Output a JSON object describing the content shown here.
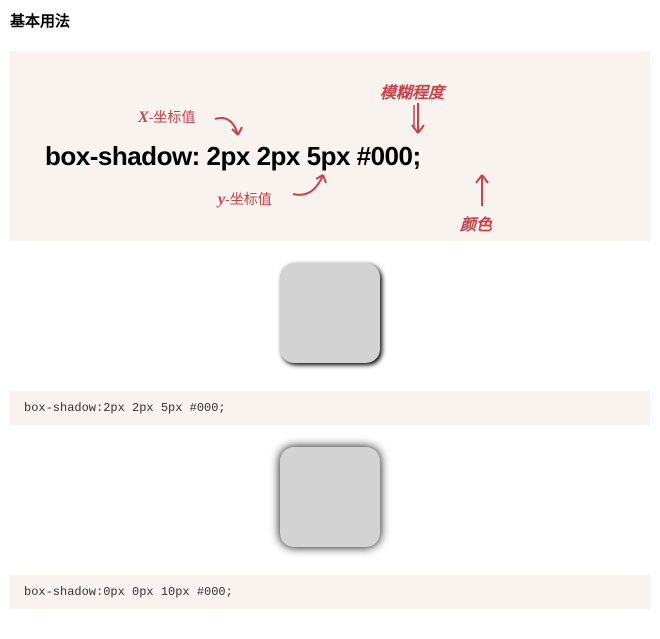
{
  "title": "基本用法",
  "main_css": "box-shadow: 2px 2px 5px #000;",
  "annotations": {
    "x_letter": "X",
    "x_suffix": "-坐标值",
    "y_letter": "y",
    "y_suffix": "-坐标值",
    "blur": "模糊程度",
    "color": "颜色"
  },
  "examples": [
    {
      "css": "box-shadow:2px 2px 5px #000;"
    },
    {
      "css": "box-shadow:0px 0px 10px #000;"
    }
  ]
}
